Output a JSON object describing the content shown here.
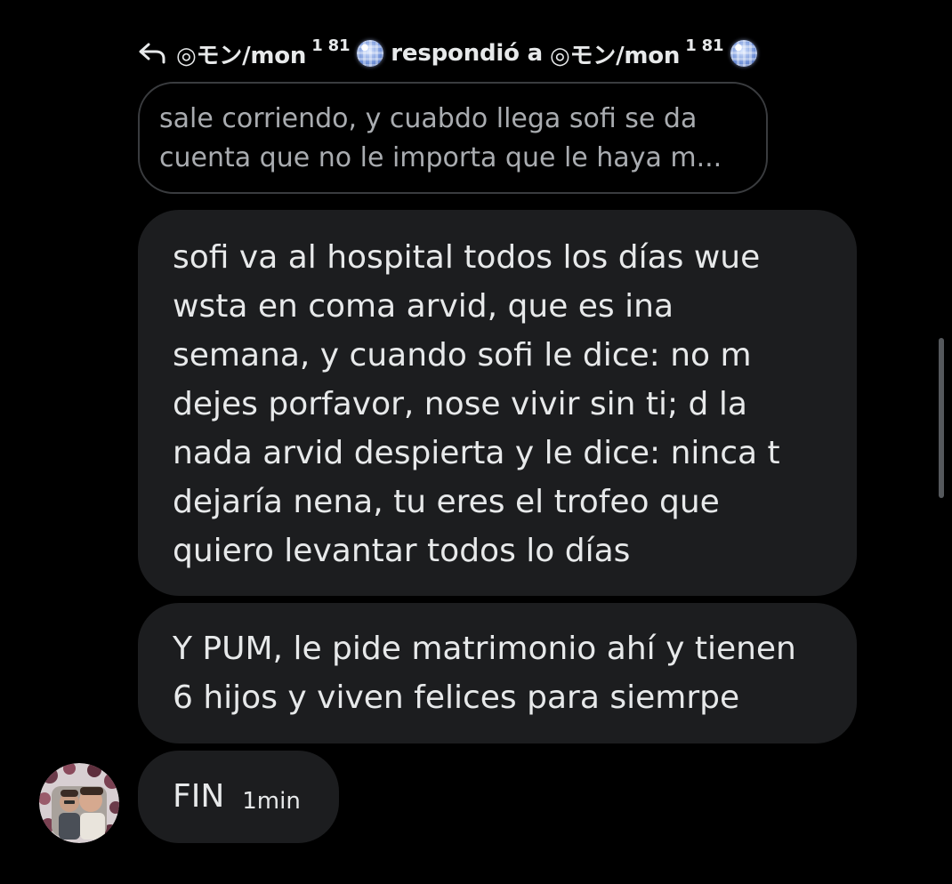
{
  "reply_header": {
    "author_name": "◎モン/mon",
    "author_badge": "1 81",
    "action_text": "respondió a",
    "target_name": "◎モン/mon",
    "target_badge": "1 81",
    "icons": [
      "reply-arrow-icon",
      "disco-ball-icon"
    ]
  },
  "quoted_message": {
    "lines": [
      "sale corriendo, y cuabdo llega sofi se da",
      "cuenta que no le importa que le haya m..."
    ]
  },
  "messages": [
    {
      "lines": [
        "sofi va al hospital todos los días wue",
        "wsta en coma arvid, que es ina",
        "semana, y cuando sofi le dice: no m",
        "dejes porfavor, nose vivir sin ti; d la",
        "nada arvid despierta y le dice: ninca t",
        "dejaría nena, tu eres el trofeo que",
        "quiero levantar todos lo días"
      ]
    },
    {
      "lines": [
        "Y PUM, le pide matrimonio ahí y tienen",
        "6 hijos y viven felices para siemrpe"
      ]
    },
    {
      "text": "FIN",
      "timestamp": "1min"
    }
  ],
  "colors": {
    "background": "#000000",
    "bubble": "#1c1d1f",
    "text": "#e7e9ea",
    "quoted_text": "#a9acb0",
    "quoted_border": "#3a3c3f"
  }
}
